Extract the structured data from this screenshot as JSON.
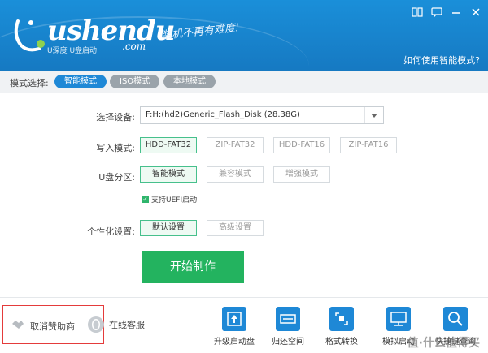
{
  "header": {
    "logo_text": "ushendu",
    "logo_com": ".com",
    "logo_sub": "U深度 U盘启动",
    "slogan": "装机不再有难度!",
    "help_link": "如何使用智能模式?",
    "window_buttons": [
      "book-icon",
      "chat-icon",
      "minimize-icon",
      "close-icon"
    ]
  },
  "mode": {
    "label": "模式选择:",
    "options": [
      "智能模式",
      "ISO模式",
      "本地模式"
    ],
    "selected": "智能模式"
  },
  "device": {
    "label": "选择设备:",
    "value": "F:H:(hd2)Generic_Flash_Disk (28.38G)"
  },
  "write_mode": {
    "label": "写入模式:",
    "options": [
      "HDD-FAT32",
      "ZIP-FAT32",
      "HDD-FAT16",
      "ZIP-FAT16"
    ],
    "selected": "HDD-FAT32"
  },
  "partition": {
    "label": "U盘分区:",
    "options": [
      "智能模式",
      "兼容模式",
      "增强模式"
    ],
    "selected": "智能模式",
    "uefi_label": "支持UEFI启动",
    "uefi_checked": true
  },
  "personalize": {
    "label": "个性化设置:",
    "options": [
      "默认设置",
      "高级设置"
    ],
    "selected": "默认设置"
  },
  "start_button": "开始制作",
  "bottom": {
    "cancel_sponsor": "取消赞助商",
    "online_service": "在线客服",
    "tools": [
      {
        "label": "升级启动盘",
        "icon": "upgrade-icon"
      },
      {
        "label": "归还空间",
        "icon": "restore-space-icon"
      },
      {
        "label": "格式转换",
        "icon": "format-convert-icon"
      },
      {
        "label": "模拟启动",
        "icon": "simulate-boot-icon"
      },
      {
        "label": "快捷键查询",
        "icon": "hotkey-search-icon"
      }
    ]
  },
  "watermark": "值·什么值得买",
  "colors": {
    "header_blue": "#1679c2",
    "accent_blue": "#1e88d6",
    "green": "#23b35f",
    "selected_border": "#46c08c",
    "highlight_red": "#e43b3b"
  }
}
